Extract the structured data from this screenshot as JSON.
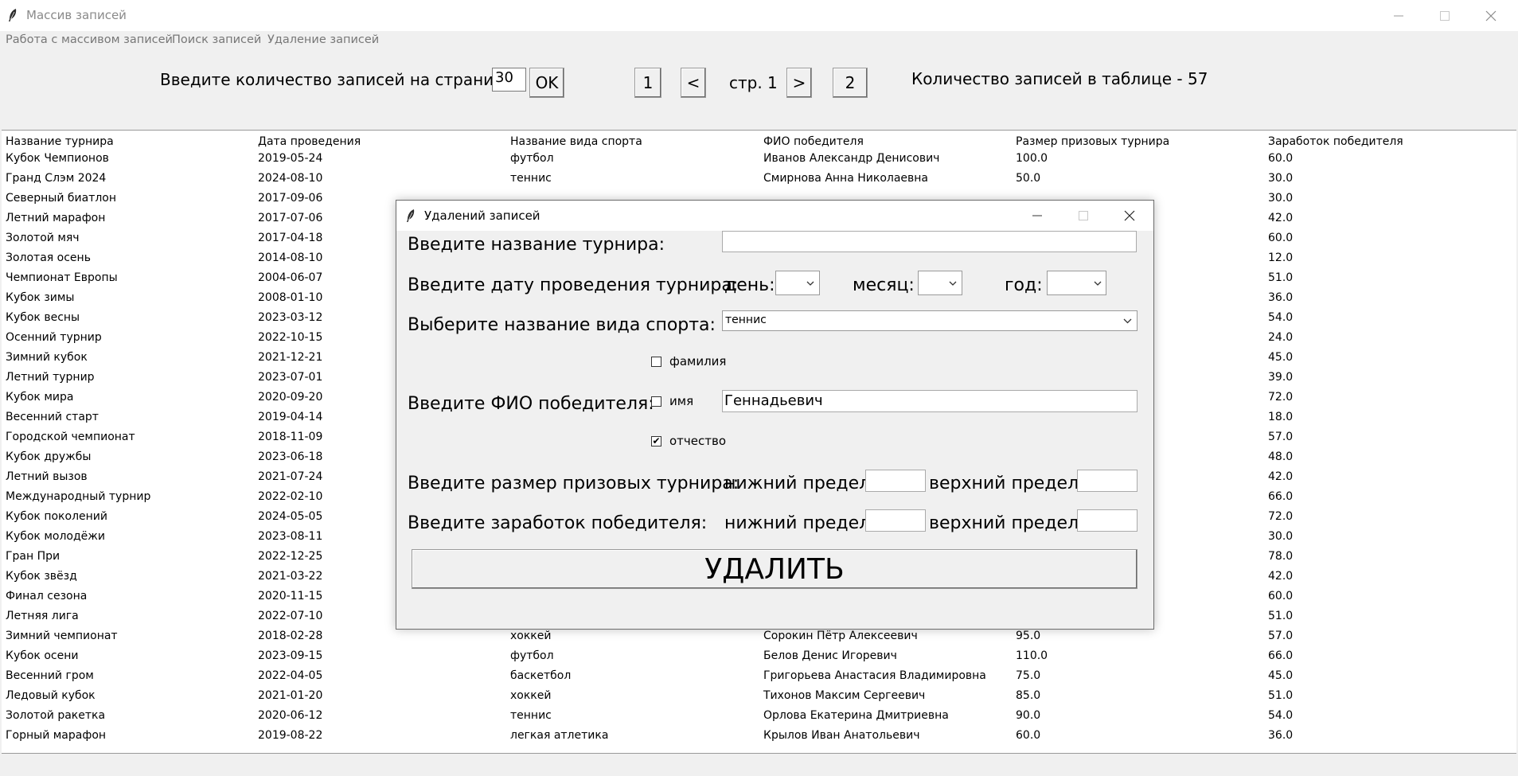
{
  "window": {
    "title": "Массив записей"
  },
  "menu": [
    "Работа с массивом записей",
    "Поиск записей",
    "Удаление записей"
  ],
  "pager": {
    "prompt": "Введите количество записей на странице:",
    "per_page_value": "30",
    "ok_label": "OK",
    "first_label": "1",
    "prev_label": "<",
    "page_label": "стр. 1",
    "next_label": ">",
    "last_label": "2",
    "count_label": "Количество записей в таблице - 57"
  },
  "table": {
    "headers": [
      "Название турнира",
      "Дата проведения",
      "Название вида спорта",
      "ФИО победителя",
      "Размер призовых турнира",
      "Заработок победителя"
    ],
    "rows": [
      [
        "Кубок Чемпионов",
        "2019-05-24",
        "футбол",
        "Иванов Александр Денисович",
        "100.0",
        "60.0"
      ],
      [
        "Гранд Слэм 2024",
        "2024-08-10",
        "теннис",
        "Смирнова Анна Николаевна",
        "50.0",
        "30.0"
      ],
      [
        "Северный биатлон",
        "2017-09-06",
        "",
        "",
        "",
        "30.0"
      ],
      [
        "Летний марафон",
        "2017-07-06",
        "",
        "",
        "",
        "42.0"
      ],
      [
        "Золотой мяч",
        "2017-04-18",
        "",
        "",
        "",
        "60.0"
      ],
      [
        "Золотая осень",
        "2014-08-10",
        "",
        "",
        "",
        "12.0"
      ],
      [
        "Чемпионат Европы",
        "2004-06-07",
        "",
        "",
        "",
        "51.0"
      ],
      [
        "Кубок зимы",
        "2008-01-10",
        "",
        "",
        "",
        "36.0"
      ],
      [
        "Кубок весны",
        "2023-03-12",
        "",
        "",
        "",
        "54.0"
      ],
      [
        "Осенний турнир",
        "2022-10-15",
        "",
        "",
        "",
        "24.0"
      ],
      [
        "Зимний кубок",
        "2021-12-21",
        "",
        "",
        "",
        "45.0"
      ],
      [
        "Летний турнир",
        "2023-07-01",
        "",
        "",
        "",
        "39.0"
      ],
      [
        "Кубок мира",
        "2020-09-20",
        "",
        "",
        "",
        "72.0"
      ],
      [
        "Весенний старт",
        "2019-04-14",
        "",
        "",
        "",
        "18.0"
      ],
      [
        "Городской чемпионат",
        "2018-11-09",
        "",
        "",
        "",
        "57.0"
      ],
      [
        "Кубок дружбы",
        "2023-06-18",
        "",
        "",
        "",
        "48.0"
      ],
      [
        "Летний вызов",
        "2021-07-24",
        "",
        "",
        "",
        "42.0"
      ],
      [
        "Международный турнир",
        "2022-02-10",
        "",
        "",
        "",
        "66.0"
      ],
      [
        "Кубок поколений",
        "2024-05-05",
        "",
        "",
        "",
        "72.0"
      ],
      [
        "Кубок молодёжи",
        "2023-08-11",
        "",
        "",
        "",
        "30.0"
      ],
      [
        "Гран При",
        "2022-12-25",
        "",
        "",
        "",
        "78.0"
      ],
      [
        "Кубок звёзд",
        "2021-03-22",
        "",
        "",
        "",
        "42.0"
      ],
      [
        "Финал сезона",
        "2020-11-15",
        "",
        "",
        "",
        "60.0"
      ],
      [
        "Летняя лига",
        "2022-07-10",
        "",
        "",
        "",
        "51.0"
      ],
      [
        "Зимний чемпионат",
        "2018-02-28",
        "хоккей",
        "Сорокин Пётр Алексеевич",
        "95.0",
        "57.0"
      ],
      [
        "Кубок осени",
        "2023-09-15",
        "футбол",
        "Белов Денис Игоревич",
        "110.0",
        "66.0"
      ],
      [
        "Весенний гром",
        "2022-04-05",
        "баскетбол",
        "Григорьева Анастасия Владимировна",
        "75.0",
        "45.0"
      ],
      [
        "Ледовый кубок",
        "2021-01-20",
        "хоккей",
        "Тихонов Максим Сергеевич",
        "85.0",
        "51.0"
      ],
      [
        "Золотой ракетка",
        "2020-06-12",
        "теннис",
        "Орлова Екатерина Дмитриевна",
        "90.0",
        "54.0"
      ],
      [
        "Горный марафон",
        "2019-08-22",
        "легкая атлетика",
        "Крылов Иван Анатольевич",
        "60.0",
        "36.0"
      ]
    ]
  },
  "dialog": {
    "title": "Удалений записей",
    "tournament_label": "Введите название турнира:",
    "tournament_value": "",
    "date_label": "Введите дату проведения турнира:",
    "day_label": "день:",
    "day_value": "",
    "month_label": "месяц:",
    "month_value": "",
    "year_label": "год:",
    "year_value": "",
    "sport_label": "Выберите название вида спорта:",
    "sport_value": "теннис",
    "fio_label": "Введите ФИО победителя:",
    "chk_surname_label": "фамилия",
    "chk_surname_checked": false,
    "chk_name_label": "имя",
    "chk_name_checked": false,
    "chk_patronymic_label": "отчество",
    "chk_patronymic_checked": true,
    "fio_value": "Геннадьевич",
    "prize_label": "Введите размер призовых турнира:",
    "earn_label": "Введите заработок победителя:",
    "lower_label": "нижний предел:",
    "upper_label": "верхний предел:",
    "prize_lower": "",
    "prize_upper": "",
    "earn_lower": "",
    "earn_upper": "",
    "delete_label": "УДАЛИТЬ"
  }
}
